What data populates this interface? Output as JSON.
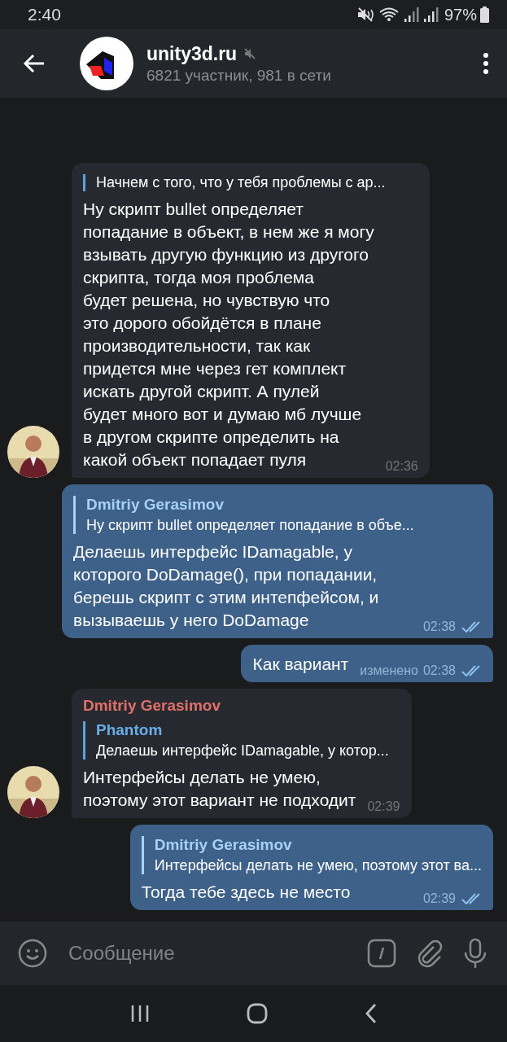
{
  "status_bar": {
    "time": "2:40",
    "battery": "97%"
  },
  "header": {
    "title": "unity3d.ru",
    "subtitle": "6821 участник, 981 в сети",
    "muted": true
  },
  "messages": [
    {
      "kind": "incoming",
      "avatar": true,
      "reply": {
        "text": "Начнем с того, что у тебя проблемы с ар..."
      },
      "text": "Ну скрипт bullet определяет\nпопадание в объект, в нем же я могу\nвзывать другую функцию из другого\nскрипта, тогда моя проблема\nбудет решена, но чувствую что\nэто дорого обойдётся в плане\nпроизводительности, так как\nпридется мне через гет комплект\nискать другой скрипт. А пулей\nбудет много вот и думаю мб лучше\nв другом скрипте определить на\nкакой объект попадает пуля",
      "time": "02:36"
    },
    {
      "kind": "outgoing",
      "reply": {
        "name": "Dmitriy Gerasimov",
        "text": "Ну скрипт bullet определяет попадание в объе..."
      },
      "text": "Делаешь интерфейс IDamagable, у которого DoDamage(), при попадании, берешь скрипт с этим интепфейсом, и вызываешь у него DoDamage",
      "time": "02:38",
      "read": true
    },
    {
      "kind": "outgoing",
      "text": "Как вариант",
      "edited": "изменено",
      "time": "02:38",
      "read": true
    },
    {
      "kind": "incoming",
      "avatar": true,
      "sender": "Dmitriy Gerasimov",
      "reply": {
        "name": "Phantom",
        "text": "Делаешь интерфейс IDamagable, у котор..."
      },
      "text": "Интерфейсы делать не умею,\nпоэтому этот вариант не подходит",
      "time": "02:39"
    },
    {
      "kind": "outgoing",
      "reply": {
        "name": "Dmitriy Gerasimov",
        "text": "Интерфейсы делать не умею, поэтому этот ва..."
      },
      "text": "Тогда тебе здесь не место",
      "time": "02:39",
      "read": true
    }
  ],
  "composer": {
    "placeholder": "Сообщение"
  }
}
